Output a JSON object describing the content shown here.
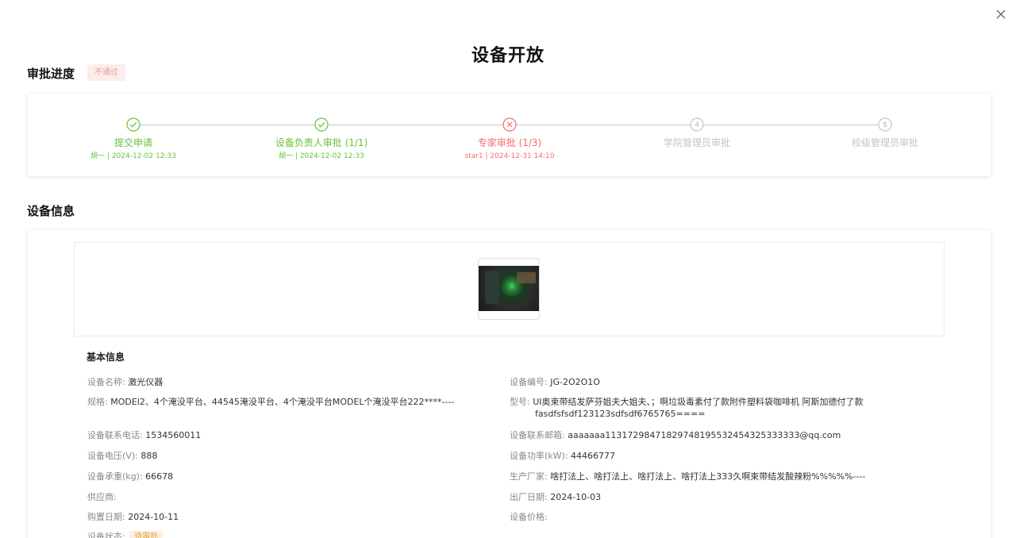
{
  "page_title": "设备开放",
  "approval": {
    "section_title": "审批进度",
    "status_badge": "不通过",
    "steps": [
      {
        "label": "提交申请",
        "meta": "胡一 | 2024-12-02 12:33",
        "state": "done"
      },
      {
        "label": "设备负责人审批 (1/1)",
        "meta": "胡一 | 2024-12-02 12:33",
        "state": "done"
      },
      {
        "label": "专家审批 (1/3)",
        "meta": "star1 | 2024-12-31 14:10",
        "state": "fail"
      },
      {
        "label": "学院管理员审批",
        "meta": "",
        "state": "wait",
        "number": "4"
      },
      {
        "label": "校级管理员审批",
        "meta": "",
        "state": "wait",
        "number": "5"
      }
    ]
  },
  "device": {
    "section_title": "设备信息",
    "basic_info_title": "基本信息",
    "fields": {
      "name": {
        "label": "设备名称:",
        "value": "激光仪器"
      },
      "code": {
        "label": "设备编号:",
        "value": "JG-2O2O1O"
      },
      "spec": {
        "label": "规格:",
        "value": "MODEl2、4个淹没平台、44545淹没平台、4个淹没平台MODEL个淹没平台222****----"
      },
      "model": {
        "label": "型号:",
        "value_line1": "UI奥束带结发萨芬姐夫大姐夫、；啊垃圾毒素付了款附件塑料袋咖啡机 阿斯加德付了款",
        "value_line2": "fasdfsfsdf123123sdfsdf6765765===="
      },
      "phone": {
        "label": "设备联系电话:",
        "value": "1534560011"
      },
      "email": {
        "label": "设备联系邮箱:",
        "value": "aaaaaaa11317298471829748195532454325333333@qq.com"
      },
      "voltage": {
        "label": "设备电压(V):",
        "value": "888"
      },
      "power": {
        "label": "设备功率(kW):",
        "value": "44466777"
      },
      "load": {
        "label": "设备承重(kg):",
        "value": "66678"
      },
      "manufacturer": {
        "label": "生产厂家:",
        "value": "啥打法上、啥打法上、啥打法上、啥打法上333久啊束带结发酸辣粉%%%%%----"
      },
      "supplier": {
        "label": "供应商:",
        "value": ""
      },
      "factory_date": {
        "label": "出厂日期:",
        "value": "2024-10-03"
      },
      "purchase_date": {
        "label": "购置日期:",
        "value": "2024-10-11"
      },
      "price": {
        "label": "设备价格:",
        "value": ""
      },
      "status": {
        "label": "设备状态:",
        "value": "待审批"
      }
    }
  },
  "colors": {
    "success": "#67c23a",
    "danger": "#f56c6c",
    "inactive": "#c4c4c4",
    "warning": "#e6a23c"
  }
}
